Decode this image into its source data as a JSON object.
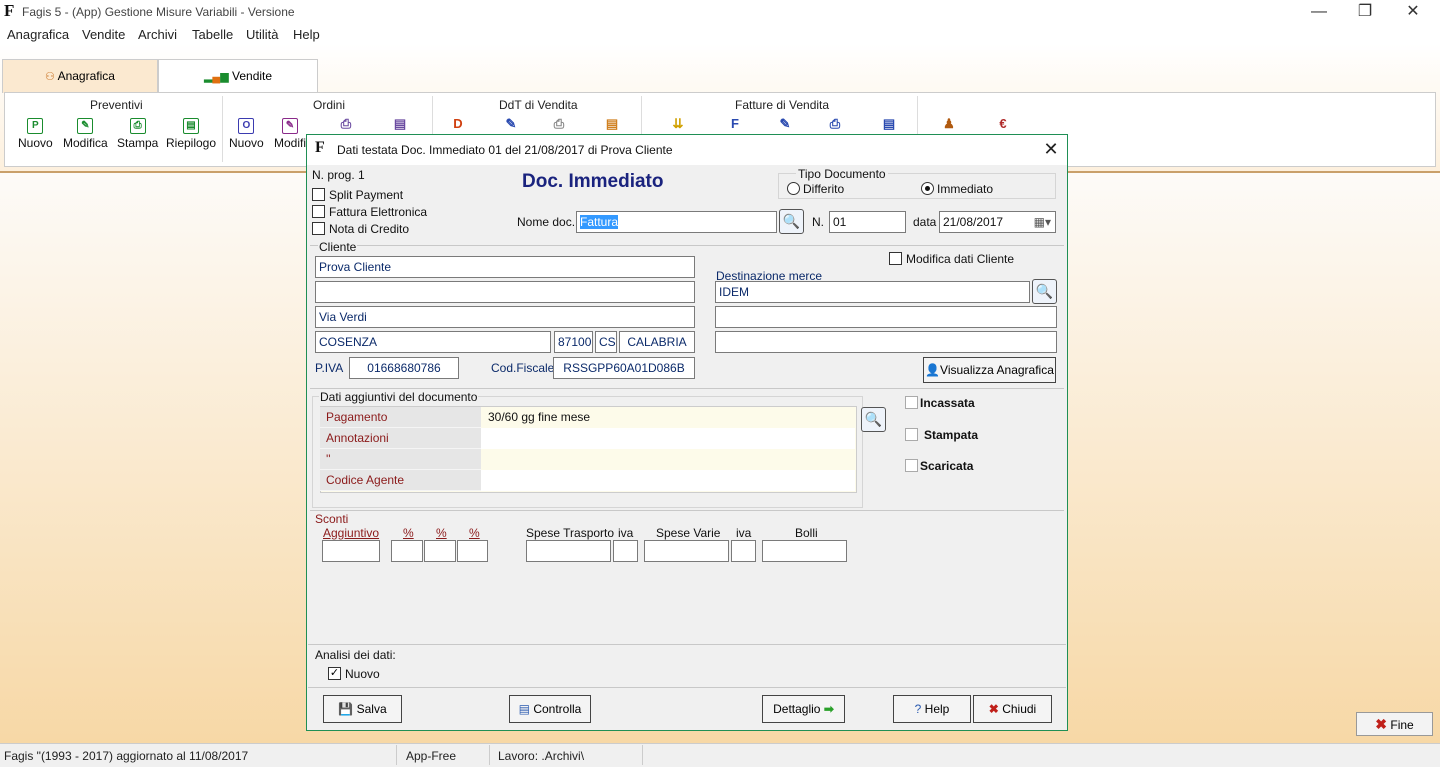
{
  "window": {
    "title": "Fagis 5  - (App) Gestione Misure Variabili - Versione",
    "logo": "F",
    "minimize": "—",
    "maximize": "❐",
    "close": "✕"
  },
  "menu": [
    "Anagrafica",
    "Vendite",
    "Archivi",
    "Tabelle",
    "Utilità",
    "Help"
  ],
  "tabs": [
    {
      "label": "Anagrafica",
      "icon": "people-icon"
    },
    {
      "label": "Vendite",
      "icon": "bar-chart-icon"
    }
  ],
  "ribbon": {
    "groups": [
      "Preventivi",
      "Ordini",
      "DdT di Vendita",
      "Fatture di Vendita"
    ],
    "buttons": [
      {
        "label": "Nuovo",
        "glyph": "P",
        "color": "#1a8c2e"
      },
      {
        "label": "Modifica",
        "glyph": "✎",
        "color": "#1a8c2e"
      },
      {
        "label": "Stampa",
        "glyph": "⎙",
        "color": "#1a8c2e"
      },
      {
        "label": "Riepilogo",
        "glyph": "▤",
        "color": "#1a8c2e"
      },
      {
        "label": "Nuovo",
        "glyph": "O",
        "color": "#3b3bb0"
      },
      {
        "label": "Modifi",
        "glyph": "✎",
        "color": "#8a2a8a"
      }
    ],
    "partial_icons": [
      {
        "glyph": "⎙",
        "color": "#6a4aa0"
      },
      {
        "glyph": "▤",
        "color": "#6a4aa0"
      },
      {
        "glyph": "D",
        "color": "#d04010"
      },
      {
        "glyph": "✎",
        "color": "#2a4ab0"
      },
      {
        "glyph": "⎙",
        "color": "#888888"
      },
      {
        "glyph": "▤",
        "color": "#d08020"
      },
      {
        "glyph": "⇊",
        "color": "#d0a000"
      },
      {
        "glyph": "F",
        "color": "#2a4ab0"
      },
      {
        "glyph": "✎",
        "color": "#2a4ab0"
      },
      {
        "glyph": "⎙",
        "color": "#2a4ab0"
      },
      {
        "glyph": "▤",
        "color": "#2a4ab0"
      },
      {
        "glyph": "♟",
        "color": "#b05a10"
      },
      {
        "glyph": "€",
        "color": "#b02a2a"
      }
    ]
  },
  "status": {
    "left": "Fagis \"(1993 - 2017)  aggiornato al 11/08/2017",
    "middle": "App-Free",
    "right": "Lavoro:  .Archivi\\"
  },
  "fine_button": {
    "label": "Fine",
    "icon": "✖"
  },
  "dialog": {
    "title": "Dati testata Doc. Immediato 01 del 21/08/2017 di Prova Cliente",
    "close": "✕",
    "nprog": "N. prog. 1",
    "heading": "Doc. Immediato",
    "checks": [
      {
        "label": "Split Payment",
        "checked": false
      },
      {
        "label": "Fattura Elettronica",
        "checked": false
      },
      {
        "label": "Nota di Credito",
        "checked": false
      }
    ],
    "tipo_documento": {
      "label": "Tipo Documento",
      "options": [
        {
          "label": "Differito",
          "selected": false
        },
        {
          "label": "Immediato",
          "selected": true
        }
      ]
    },
    "nome_doc": {
      "label": "Nome doc.",
      "value": "Fattura"
    },
    "numero": {
      "label": "N.",
      "value": "01"
    },
    "data": {
      "label": "data",
      "value": "21/08/2017"
    },
    "cliente": {
      "label": "Cliente",
      "name": "Prova Cliente",
      "line2": "",
      "address": "Via Verdi",
      "city": "COSENZA",
      "cap": "87100",
      "prov": "CS",
      "region": "CALABRIA",
      "piva_label": "P.IVA",
      "piva": "01668680786",
      "cf_label": "Cod.Fiscale",
      "cf": "RSSGPP60A01D086B"
    },
    "modifica_dati": {
      "label": "Modifica dati Cliente",
      "checked": false
    },
    "destinazione": {
      "label": "Destinazione merce",
      "line1": "IDEM",
      "line2": "",
      "line3": ""
    },
    "visualizza_btn": "Visualizza Anagrafica",
    "dati_aggiuntivi": {
      "label": "Dati aggiuntivi del documento",
      "rows": [
        {
          "key": "Pagamento",
          "value": "30/60 gg fine mese"
        },
        {
          "key": "Annotazioni",
          "value": ""
        },
        {
          "key": "''",
          "value": ""
        },
        {
          "key": "Codice Agente",
          "value": ""
        }
      ]
    },
    "status_checks": [
      {
        "label": "Incassata",
        "checked": false
      },
      {
        "label": "Stampata",
        "checked": false
      },
      {
        "label": "Scaricata",
        "checked": false
      }
    ],
    "sconti": {
      "label": "Sconti",
      "aggiuntivo": "Aggiuntivo",
      "pct1": "%",
      "pct2": "%",
      "pct3": "%",
      "spese_trasporto": "Spese Trasporto",
      "iva1": "iva",
      "spese_varie": "Spese Varie",
      "iva2": "iva",
      "bolli": "Bolli"
    },
    "analisi": {
      "label": "Analisi dei dati:",
      "nuovo": "Nuovo",
      "checked": true
    },
    "buttons": {
      "salva": "Salva",
      "controlla": "Controlla",
      "dettaglio": "Dettaglio",
      "help": "Help",
      "chiudi": "Chiudi"
    }
  }
}
